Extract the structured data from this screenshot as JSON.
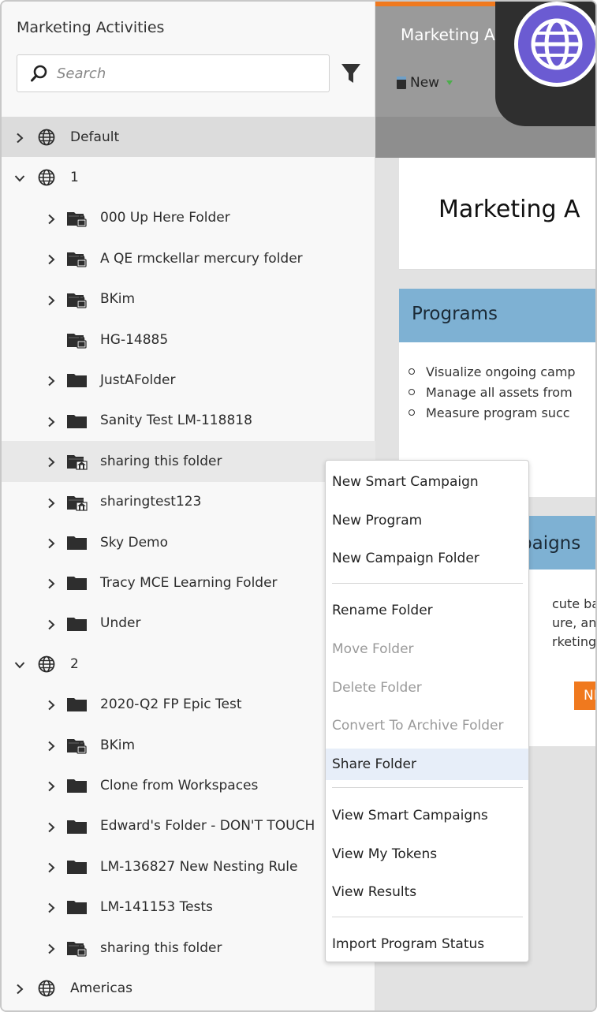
{
  "panel": {
    "title": "Marketing Activities",
    "search_placeholder": "Search",
    "search_value": ""
  },
  "tree": [
    {
      "label": "Default",
      "level": 0,
      "icon": "globe-icon",
      "expand": "collapsed",
      "state": "selected"
    },
    {
      "label": "1",
      "level": 0,
      "icon": "globe-icon",
      "expand": "expanded",
      "state": ""
    },
    {
      "label": "000 Up Here Folder",
      "level": 1,
      "icon": "locked-folder-icon",
      "expand": "collapsed",
      "state": ""
    },
    {
      "label": "A QE rmckellar mercury folder",
      "level": 1,
      "icon": "locked-folder-icon",
      "expand": "collapsed",
      "state": ""
    },
    {
      "label": "BKim",
      "level": 1,
      "icon": "locked-folder-icon",
      "expand": "collapsed",
      "state": ""
    },
    {
      "label": "HG-14885",
      "level": 1,
      "icon": "locked-folder-icon",
      "expand": "none",
      "state": ""
    },
    {
      "label": "JustAFolder",
      "level": 1,
      "icon": "folder-icon",
      "expand": "collapsed",
      "state": ""
    },
    {
      "label": "Sanity Test LM-118818",
      "level": 1,
      "icon": "folder-icon",
      "expand": "collapsed",
      "state": ""
    },
    {
      "label": "sharing this folder",
      "level": 1,
      "icon": "shared-folder-icon",
      "expand": "collapsed",
      "state": "hover"
    },
    {
      "label": "sharingtest123",
      "level": 1,
      "icon": "shared-folder-icon",
      "expand": "collapsed",
      "state": ""
    },
    {
      "label": "Sky Demo",
      "level": 1,
      "icon": "folder-icon",
      "expand": "collapsed",
      "state": ""
    },
    {
      "label": "Tracy MCE Learning Folder",
      "level": 1,
      "icon": "folder-icon",
      "expand": "collapsed",
      "state": ""
    },
    {
      "label": "Under",
      "level": 1,
      "icon": "folder-icon",
      "expand": "collapsed",
      "state": ""
    },
    {
      "label": "2",
      "level": 0,
      "icon": "globe-icon",
      "expand": "expanded",
      "state": ""
    },
    {
      "label": "2020-Q2 FP Epic Test",
      "level": 1,
      "icon": "folder-icon",
      "expand": "collapsed",
      "state": ""
    },
    {
      "label": "BKim",
      "level": 1,
      "icon": "locked-folder-icon",
      "expand": "collapsed",
      "state": ""
    },
    {
      "label": "Clone from Workspaces",
      "level": 1,
      "icon": "folder-icon",
      "expand": "collapsed",
      "state": ""
    },
    {
      "label": "Edward's Folder - DON'T TOUCH",
      "level": 1,
      "icon": "folder-icon",
      "expand": "collapsed",
      "state": ""
    },
    {
      "label": "LM-136827 New Nesting Rule",
      "level": 1,
      "icon": "folder-icon",
      "expand": "collapsed",
      "state": ""
    },
    {
      "label": "LM-141153 Tests",
      "level": 1,
      "icon": "folder-icon",
      "expand": "collapsed",
      "state": ""
    },
    {
      "label": "sharing this folder",
      "level": 1,
      "icon": "locked-folder-icon",
      "expand": "collapsed",
      "state": ""
    },
    {
      "label": "Americas",
      "level": 0,
      "icon": "globe-icon",
      "expand": "collapsed",
      "state": ""
    }
  ],
  "main": {
    "tab_title": "Marketing A",
    "new_label": "New",
    "card_title": "Marketing A",
    "programs_title": "Programs",
    "programs_items": [
      "Visualize ongoing camp",
      "Manage all assets from",
      "Measure program succ"
    ],
    "campaigns_title": "paigns",
    "campaigns_lines": [
      "cute batch",
      "ure, and s",
      "rketing pr"
    ],
    "campaigns_button": "NE"
  },
  "context_menu": {
    "items": [
      {
        "label": "New Smart Campaign",
        "state": "enabled"
      },
      {
        "label": "New Program",
        "state": "enabled"
      },
      {
        "label": "New Campaign Folder",
        "state": "enabled"
      },
      {
        "label": "Rename Folder",
        "state": "enabled"
      },
      {
        "label": "Move Folder",
        "state": "disabled"
      },
      {
        "label": "Delete Folder",
        "state": "disabled"
      },
      {
        "label": "Convert To Archive Folder",
        "state": "disabled"
      },
      {
        "label": "Share Folder",
        "state": "active"
      },
      {
        "label": "View Smart Campaigns",
        "state": "enabled"
      },
      {
        "label": "View My Tokens",
        "state": "enabled"
      },
      {
        "label": "View Results",
        "state": "enabled"
      },
      {
        "label": "Import Program Status",
        "state": "enabled"
      }
    ]
  },
  "colors": {
    "accent_orange": "#f0791e",
    "header_blue": "#7eb1d3",
    "badge_purple": "#6b5bd2"
  }
}
